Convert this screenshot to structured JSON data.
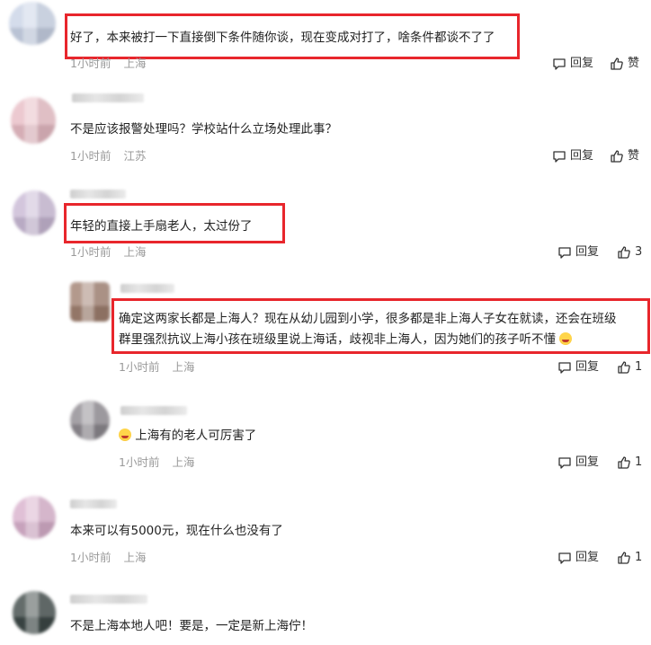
{
  "actions": {
    "reply": "回复",
    "like": "赞"
  },
  "comments": [
    {
      "text": "好了，本来被打一下直接倒下条件随你谈，现在变成对打了，啥条件都谈不了了",
      "time": "1小时前",
      "location": "上海",
      "likes": ""
    },
    {
      "text": "不是应该报警处理吗？学校站什么立场处理此事？",
      "time": "1小时前",
      "location": "江苏",
      "likes": ""
    },
    {
      "text": "年轻的直接上手扇老人，太过份了",
      "time": "1小时前",
      "location": "上海",
      "likes": "3"
    },
    {
      "text_line1": "确定这两家长都是上海人？现在从幼儿园到小学，很多都是非上海人子女在就读，还会在班级",
      "text_line2": "群里强烈抗议上海小孩在班级里说上海话，歧视非上海人，因为她们的孩子听不懂",
      "time": "1小时前",
      "location": "上海",
      "likes": "1"
    },
    {
      "text": "上海有的老人可厉害了",
      "time": "1小时前",
      "location": "上海",
      "likes": "1"
    },
    {
      "text": "本来可以有5000元，现在什么也没有了",
      "time": "1小时前",
      "location": "上海",
      "likes": "1"
    },
    {
      "text": "不是上海本地人吧！要是，一定是新上海佇！",
      "time": "",
      "location": "",
      "likes": ""
    }
  ]
}
